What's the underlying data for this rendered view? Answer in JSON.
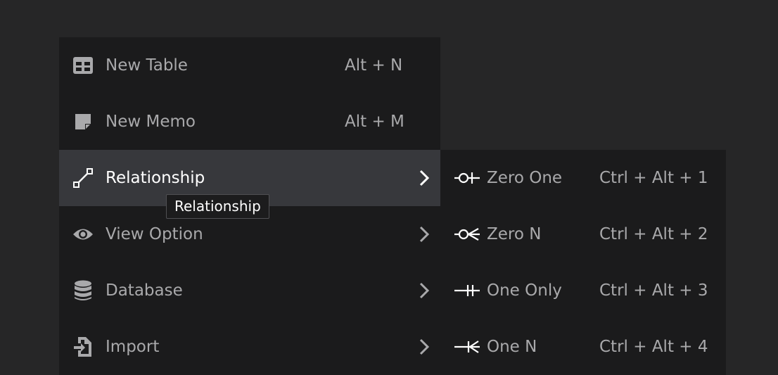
{
  "menu": {
    "items": [
      {
        "label": "New Table",
        "shortcut": "Alt + N",
        "icon": "table-icon"
      },
      {
        "label": "New Memo",
        "shortcut": "Alt + M",
        "icon": "memo-icon"
      },
      {
        "label": "Relationship",
        "icon": "relationship-icon",
        "has_submenu": true,
        "active": true
      },
      {
        "label": "View Option",
        "icon": "eye-icon",
        "has_submenu": true
      },
      {
        "label": "Database",
        "icon": "database-icon",
        "has_submenu": true
      },
      {
        "label": "Import",
        "icon": "import-icon",
        "has_submenu": true
      }
    ]
  },
  "submenu": {
    "items": [
      {
        "label": "Zero One",
        "shortcut": "Ctrl + Alt + 1",
        "icon": "zero-one-icon"
      },
      {
        "label": "Zero N",
        "shortcut": "Ctrl + Alt + 2",
        "icon": "zero-n-icon"
      },
      {
        "label": "One Only",
        "shortcut": "Ctrl + Alt + 3",
        "icon": "one-only-icon"
      },
      {
        "label": "One N",
        "shortcut": "Ctrl + Alt + 4",
        "icon": "one-n-icon"
      }
    ]
  },
  "tooltip": {
    "text": "Relationship"
  },
  "colors": {
    "background": "#262627",
    "menu_background": "#1b1b1c",
    "active_background": "#37383c",
    "text": "#a9a9ab",
    "active_text": "#ffffff"
  }
}
